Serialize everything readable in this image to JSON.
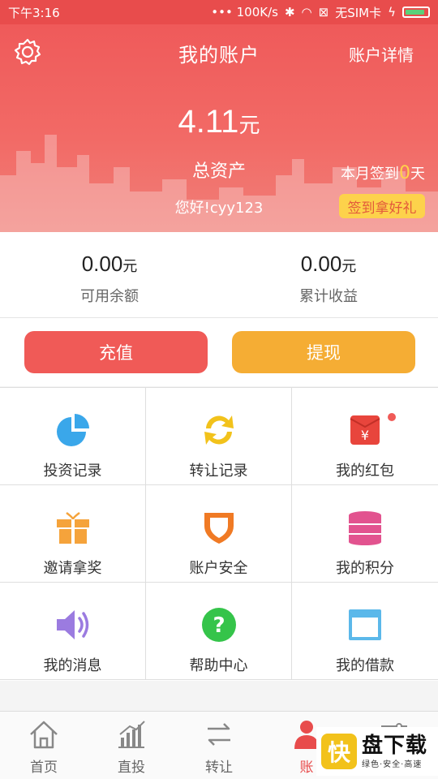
{
  "status_bar": {
    "time": "下午3:16",
    "speed": "••• 100K/s",
    "carrier": "无SIM卡"
  },
  "header": {
    "title": "我的账户",
    "detail_link": "账户详情",
    "total_value": "4.11",
    "total_unit": "元",
    "total_label": "总资产",
    "greeting": "您好!cyy123",
    "checkin_prefix": "本月签到",
    "checkin_days": "0",
    "checkin_suffix": "天",
    "checkin_button": "签到拿好礼"
  },
  "balances": [
    {
      "value": "0.00",
      "unit": "元",
      "label": "可用余额"
    },
    {
      "value": "0.00",
      "unit": "元",
      "label": "累计收益"
    }
  ],
  "actions": {
    "recharge": "充值",
    "withdraw": "提现"
  },
  "menu": [
    {
      "label": "投资记录",
      "icon": "pie-chart-icon"
    },
    {
      "label": "转让记录",
      "icon": "exchange-arrows-icon"
    },
    {
      "label": "我的红包",
      "icon": "red-envelope-icon"
    },
    {
      "label": "邀请拿奖",
      "icon": "gift-icon"
    },
    {
      "label": "账户安全",
      "icon": "shield-icon"
    },
    {
      "label": "我的积分",
      "icon": "coin-stack-icon"
    },
    {
      "label": "我的消息",
      "icon": "speaker-icon"
    },
    {
      "label": "帮助中心",
      "icon": "help-icon"
    },
    {
      "label": "我的借款",
      "icon": "window-icon"
    }
  ],
  "tabs": [
    {
      "label": "首页",
      "icon": "home-icon"
    },
    {
      "label": "直投",
      "icon": "bar-chart-icon"
    },
    {
      "label": "转让",
      "icon": "transfer-icon"
    },
    {
      "label": "账",
      "icon": "account-icon"
    },
    {
      "label": "",
      "icon": "settings-sliders-icon"
    }
  ],
  "watermark": {
    "logo_char": "快",
    "brand": "盘下载",
    "tagline": "绿色·安全·高速"
  },
  "colors": {
    "brand_red": "#e84c4c",
    "recharge": "#f05a57",
    "withdraw": "#f5ad34",
    "checkin_button": "#fdd24b"
  }
}
